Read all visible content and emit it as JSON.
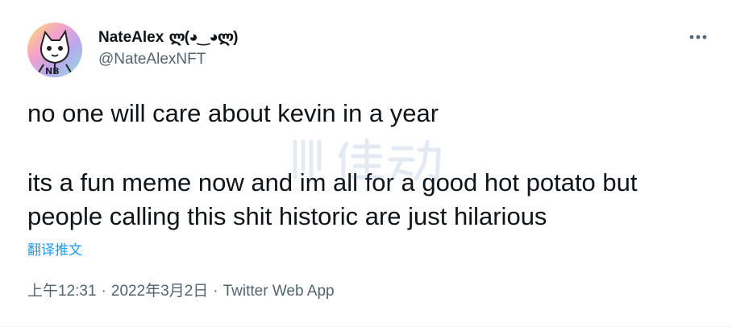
{
  "tweet": {
    "display_name": "NateAlex",
    "name_emoji": "ლ(◕‿◕ლ)",
    "handle": "@NateAlexNFT",
    "text_lines": [
      "no one will care about kevin in a year",
      "its a fun meme now and im all for a good hot potato but",
      "people calling this shit historic are just hilarious"
    ],
    "translate_label": "翻译推文",
    "time": "上午12:31",
    "date": "2022年3月2日",
    "separator": "·",
    "source": "Twitter Web App"
  },
  "icons": {
    "more": "more-options-icon",
    "avatar": "nft-cat-avatar",
    "watermark": "watermark-logo"
  },
  "colors": {
    "text": "#0f1419",
    "secondary": "#536471",
    "link": "#1d9bf0"
  }
}
